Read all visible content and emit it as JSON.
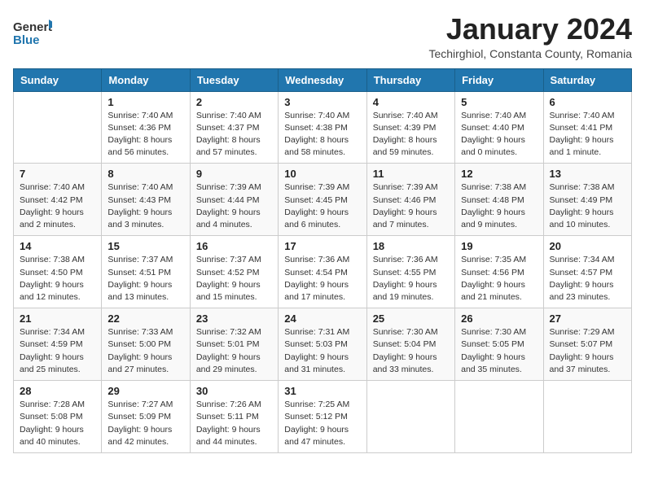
{
  "header": {
    "logo_general": "General",
    "logo_blue": "Blue",
    "title": "January 2024",
    "subtitle": "Techirghiol, Constanta County, Romania"
  },
  "weekdays": [
    "Sunday",
    "Monday",
    "Tuesday",
    "Wednesday",
    "Thursday",
    "Friday",
    "Saturday"
  ],
  "weeks": [
    [
      {
        "day": "",
        "info": ""
      },
      {
        "day": "1",
        "info": "Sunrise: 7:40 AM\nSunset: 4:36 PM\nDaylight: 8 hours\nand 56 minutes."
      },
      {
        "day": "2",
        "info": "Sunrise: 7:40 AM\nSunset: 4:37 PM\nDaylight: 8 hours\nand 57 minutes."
      },
      {
        "day": "3",
        "info": "Sunrise: 7:40 AM\nSunset: 4:38 PM\nDaylight: 8 hours\nand 58 minutes."
      },
      {
        "day": "4",
        "info": "Sunrise: 7:40 AM\nSunset: 4:39 PM\nDaylight: 8 hours\nand 59 minutes."
      },
      {
        "day": "5",
        "info": "Sunrise: 7:40 AM\nSunset: 4:40 PM\nDaylight: 9 hours\nand 0 minutes."
      },
      {
        "day": "6",
        "info": "Sunrise: 7:40 AM\nSunset: 4:41 PM\nDaylight: 9 hours\nand 1 minute."
      }
    ],
    [
      {
        "day": "7",
        "info": "Sunrise: 7:40 AM\nSunset: 4:42 PM\nDaylight: 9 hours\nand 2 minutes."
      },
      {
        "day": "8",
        "info": "Sunrise: 7:40 AM\nSunset: 4:43 PM\nDaylight: 9 hours\nand 3 minutes."
      },
      {
        "day": "9",
        "info": "Sunrise: 7:39 AM\nSunset: 4:44 PM\nDaylight: 9 hours\nand 4 minutes."
      },
      {
        "day": "10",
        "info": "Sunrise: 7:39 AM\nSunset: 4:45 PM\nDaylight: 9 hours\nand 6 minutes."
      },
      {
        "day": "11",
        "info": "Sunrise: 7:39 AM\nSunset: 4:46 PM\nDaylight: 9 hours\nand 7 minutes."
      },
      {
        "day": "12",
        "info": "Sunrise: 7:38 AM\nSunset: 4:48 PM\nDaylight: 9 hours\nand 9 minutes."
      },
      {
        "day": "13",
        "info": "Sunrise: 7:38 AM\nSunset: 4:49 PM\nDaylight: 9 hours\nand 10 minutes."
      }
    ],
    [
      {
        "day": "14",
        "info": "Sunrise: 7:38 AM\nSunset: 4:50 PM\nDaylight: 9 hours\nand 12 minutes."
      },
      {
        "day": "15",
        "info": "Sunrise: 7:37 AM\nSunset: 4:51 PM\nDaylight: 9 hours\nand 13 minutes."
      },
      {
        "day": "16",
        "info": "Sunrise: 7:37 AM\nSunset: 4:52 PM\nDaylight: 9 hours\nand 15 minutes."
      },
      {
        "day": "17",
        "info": "Sunrise: 7:36 AM\nSunset: 4:54 PM\nDaylight: 9 hours\nand 17 minutes."
      },
      {
        "day": "18",
        "info": "Sunrise: 7:36 AM\nSunset: 4:55 PM\nDaylight: 9 hours\nand 19 minutes."
      },
      {
        "day": "19",
        "info": "Sunrise: 7:35 AM\nSunset: 4:56 PM\nDaylight: 9 hours\nand 21 minutes."
      },
      {
        "day": "20",
        "info": "Sunrise: 7:34 AM\nSunset: 4:57 PM\nDaylight: 9 hours\nand 23 minutes."
      }
    ],
    [
      {
        "day": "21",
        "info": "Sunrise: 7:34 AM\nSunset: 4:59 PM\nDaylight: 9 hours\nand 25 minutes."
      },
      {
        "day": "22",
        "info": "Sunrise: 7:33 AM\nSunset: 5:00 PM\nDaylight: 9 hours\nand 27 minutes."
      },
      {
        "day": "23",
        "info": "Sunrise: 7:32 AM\nSunset: 5:01 PM\nDaylight: 9 hours\nand 29 minutes."
      },
      {
        "day": "24",
        "info": "Sunrise: 7:31 AM\nSunset: 5:03 PM\nDaylight: 9 hours\nand 31 minutes."
      },
      {
        "day": "25",
        "info": "Sunrise: 7:30 AM\nSunset: 5:04 PM\nDaylight: 9 hours\nand 33 minutes."
      },
      {
        "day": "26",
        "info": "Sunrise: 7:30 AM\nSunset: 5:05 PM\nDaylight: 9 hours\nand 35 minutes."
      },
      {
        "day": "27",
        "info": "Sunrise: 7:29 AM\nSunset: 5:07 PM\nDaylight: 9 hours\nand 37 minutes."
      }
    ],
    [
      {
        "day": "28",
        "info": "Sunrise: 7:28 AM\nSunset: 5:08 PM\nDaylight: 9 hours\nand 40 minutes."
      },
      {
        "day": "29",
        "info": "Sunrise: 7:27 AM\nSunset: 5:09 PM\nDaylight: 9 hours\nand 42 minutes."
      },
      {
        "day": "30",
        "info": "Sunrise: 7:26 AM\nSunset: 5:11 PM\nDaylight: 9 hours\nand 44 minutes."
      },
      {
        "day": "31",
        "info": "Sunrise: 7:25 AM\nSunset: 5:12 PM\nDaylight: 9 hours\nand 47 minutes."
      },
      {
        "day": "",
        "info": ""
      },
      {
        "day": "",
        "info": ""
      },
      {
        "day": "",
        "info": ""
      }
    ]
  ]
}
